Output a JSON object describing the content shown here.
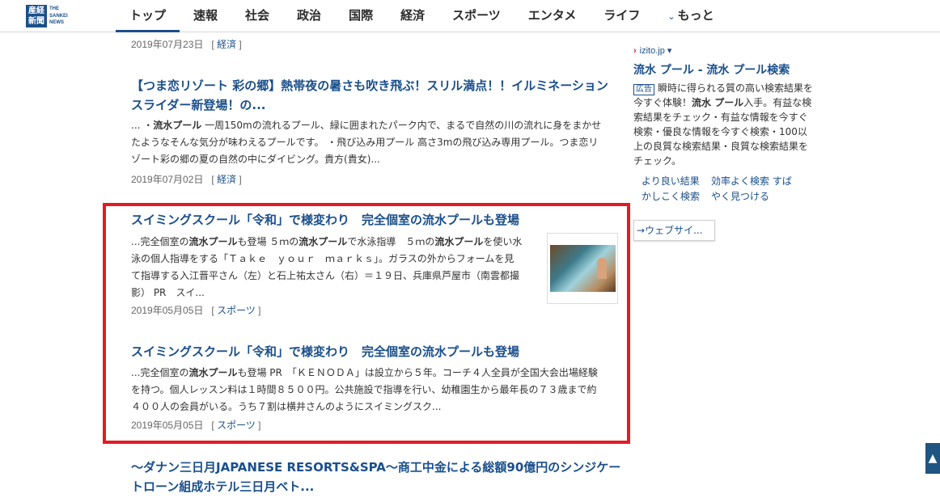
{
  "header": {
    "logo_mark": "産経\n新聞",
    "logo_text": "THE SANKEI NEWS",
    "nav": [
      "トップ",
      "速報",
      "社会",
      "政治",
      "国際",
      "経済",
      "スポーツ",
      "エンタメ",
      "ライフ"
    ],
    "nav_more": "もっと"
  },
  "results": {
    "r0": {
      "date": "2019年07月23日",
      "category": "経済"
    },
    "r1": {
      "title_line1": "【つま恋リゾート 彩の郷】熱帯夜の暑さも吹き飛ぶ！スリル満点！！イルミネーション",
      "title_line2": "スライダー新登場！の...",
      "snippet_line1_pre": "... ・",
      "snippet_line1_bold": "流水プール",
      "snippet_line1_post": " 一周150mの流れるプール、緑に囲まれたパーク内で、まるで自然の川の流れに身をまかせ",
      "snippet_line2": "たようなそんな気分が味わえるプールです。 ・飛び込み用プール 高さ3mの飛び込み専用プール。つま恋リ",
      "snippet_line3": "ゾート彩の郷の夏の自然の中にダイビング。貴方(貴女)...",
      "date": "2019年07月02日",
      "category": "経済"
    },
    "r2": {
      "title": "スイミングスクール「令和」で様変わり　完全個室の流水プールも登場",
      "snippet_line1_a": "...完全個室の",
      "snippet_line1_b": "流水プール",
      "snippet_line1_c": "も登場 ５ｍの",
      "snippet_line1_d": "流水プール",
      "snippet_line1_e": "で水泳指導　５ｍの",
      "snippet_line1_f": "流水プール",
      "snippet_line1_g": "を使い水",
      "snippet_line2": "泳の個人指導をする「Ｔａｋｅ　ｙｏｕｒ　ｍａｒｋｓ」。ガラスの外からフォームを見",
      "snippet_line3": "て指導する入江晋平さん（左）と石上祐太さん（右）＝１９日、兵庫県芦屋市（南雲都撮",
      "snippet_line4": "影） PR　スイ...",
      "date": "2019年05月05日",
      "category": "スポーツ"
    },
    "r3": {
      "title": "スイミングスクール「令和」で様変わり　完全個室の流水プールも登場",
      "snippet_line1_a": "...完全個室の",
      "snippet_line1_b": "流水プール",
      "snippet_line1_c": "も登場 PR　「ＫＥＮＯＤＡ」は設立から５年。コーチ４人全員が全国大会出場経験",
      "snippet_line2": "を持つ。個人レッスン料は１時間８５００円。公共施設で指導を行い、幼稚園生から最年長の７３歳まで約",
      "snippet_line3": "４００人の会員がいる。うち７割は横井さんのようにスイミングスク...",
      "date": "2019年05月05日",
      "category": "スポーツ"
    },
    "r4": {
      "title_line1": "〜ダナン三日月JAPANESE RESORTS&SPA〜商工中金による総額90億円のシンジケー",
      "title_line2": "トローン組成ホテル三日月ベト..."
    }
  },
  "sidebar": {
    "domain": "izito.jp",
    "title": "流水 プール - 流水 プール検索",
    "ad_label": "広告",
    "body_pre": "瞬時に得られる質の高い検索結果を今すぐ体験！",
    "body_bold": "流水 プール",
    "body_post": "入手。有益な検索結果をチェック・有益な情報を今すぐ検索・優良な情報を今すぐ検索・100以上の良質な検索結果・良質な検索結果をチェック。",
    "links_col1": [
      "より良い結果",
      "かしこく検索"
    ],
    "links_col2": "効率よく検索 すばやく見つける",
    "web_button": "ウェブサイ..."
  },
  "colors": {
    "accent": "#1a4f8b",
    "highlight": "#e31b23"
  }
}
